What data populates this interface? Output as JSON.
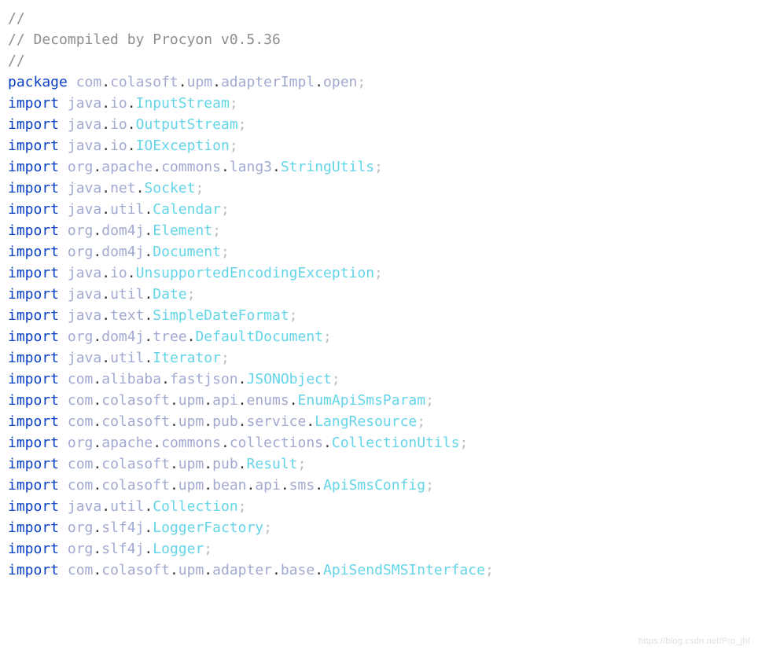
{
  "comments": {
    "l1": "// ",
    "l2": "// Decompiled by Procyon v0.5.36",
    "l3": "// "
  },
  "keywords": {
    "package": "package",
    "import": "import"
  },
  "package": {
    "segments": [
      "com",
      "colasoft",
      "upm",
      "adapterImpl",
      "open"
    ]
  },
  "imports": [
    {
      "path": [
        "java",
        "io"
      ],
      "class": "InputStream"
    },
    {
      "path": [
        "java",
        "io"
      ],
      "class": "OutputStream"
    },
    {
      "path": [
        "java",
        "io"
      ],
      "class": "IOException"
    },
    {
      "path": [
        "org",
        "apache",
        "commons",
        "lang3"
      ],
      "class": "StringUtils"
    },
    {
      "path": [
        "java",
        "net"
      ],
      "class": "Socket"
    },
    {
      "path": [
        "java",
        "util"
      ],
      "class": "Calendar"
    },
    {
      "path": [
        "org",
        "dom4j"
      ],
      "class": "Element"
    },
    {
      "path": [
        "org",
        "dom4j"
      ],
      "class": "Document"
    },
    {
      "path": [
        "java",
        "io"
      ],
      "class": "UnsupportedEncodingException"
    },
    {
      "path": [
        "java",
        "util"
      ],
      "class": "Date"
    },
    {
      "path": [
        "java",
        "text"
      ],
      "class": "SimpleDateFormat"
    },
    {
      "path": [
        "org",
        "dom4j",
        "tree"
      ],
      "class": "DefaultDocument"
    },
    {
      "path": [
        "java",
        "util"
      ],
      "class": "Iterator"
    },
    {
      "path": [
        "com",
        "alibaba",
        "fastjson"
      ],
      "class": "JSONObject"
    },
    {
      "path": [
        "com",
        "colasoft",
        "upm",
        "api",
        "enums"
      ],
      "class": "EnumApiSmsParam"
    },
    {
      "path": [
        "com",
        "colasoft",
        "upm",
        "pub",
        "service"
      ],
      "class": "LangResource"
    },
    {
      "path": [
        "org",
        "apache",
        "commons",
        "collections"
      ],
      "class": "CollectionUtils"
    },
    {
      "path": [
        "com",
        "colasoft",
        "upm",
        "pub"
      ],
      "class": "Result"
    },
    {
      "path": [
        "com",
        "colasoft",
        "upm",
        "bean",
        "api",
        "sms"
      ],
      "class": "ApiSmsConfig"
    },
    {
      "path": [
        "java",
        "util"
      ],
      "class": "Collection"
    },
    {
      "path": [
        "org",
        "slf4j"
      ],
      "class": "LoggerFactory"
    },
    {
      "path": [
        "org",
        "slf4j"
      ],
      "class": "Logger"
    },
    {
      "path": [
        "com",
        "colasoft",
        "upm",
        "adapter",
        "base"
      ],
      "class": "ApiSendSMSInterface"
    }
  ],
  "punct": {
    "dot": ".",
    "semi": ";"
  },
  "watermark": "https://blog.csdn.net/Pro_jhf"
}
